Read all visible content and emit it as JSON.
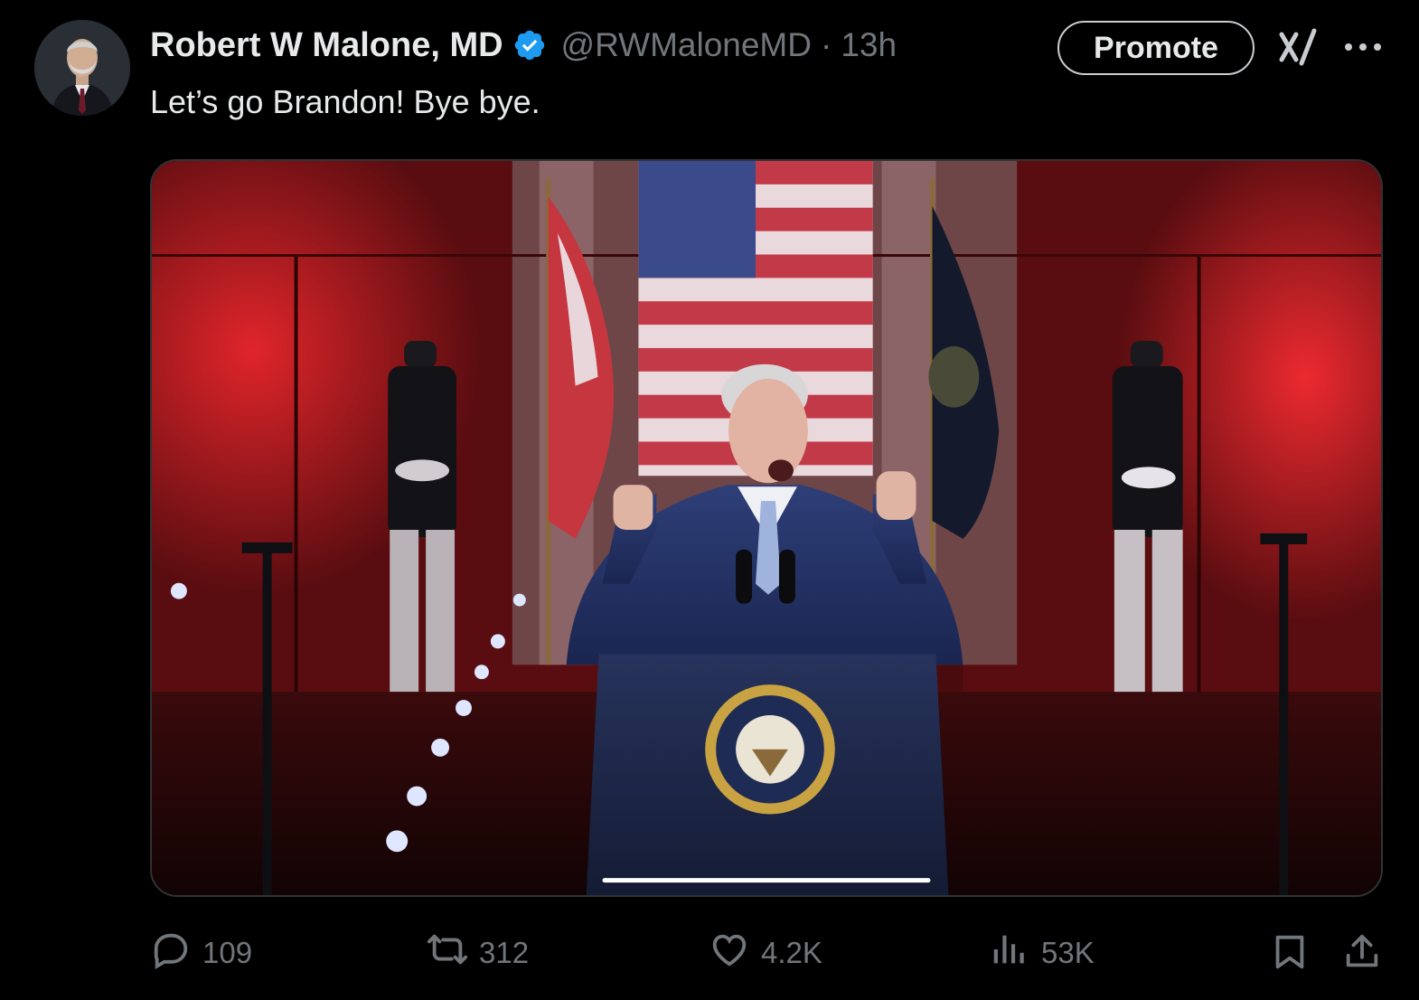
{
  "author": {
    "name": "Robert W Malone, MD",
    "handle": "@RWMaloneMD",
    "separator": "·",
    "time": "13h",
    "verified_color": "#1d9bf0"
  },
  "tweet": {
    "text": "Let’s go Brandon!  Bye bye."
  },
  "header_actions": {
    "promote_label": "Promote"
  },
  "stats": {
    "replies": "109",
    "reposts": "312",
    "likes": "4.2K",
    "views": "53K"
  },
  "icons": {
    "reply": "reply-icon",
    "repost": "repost-icon",
    "like": "heart-icon",
    "views": "views-icon",
    "bookmark": "bookmark-icon",
    "share": "share-icon",
    "grok": "grok-icon",
    "more": "more-icon"
  },
  "colors": {
    "background": "#000000",
    "text": "#e7e9ea",
    "muted": "#71767b"
  }
}
